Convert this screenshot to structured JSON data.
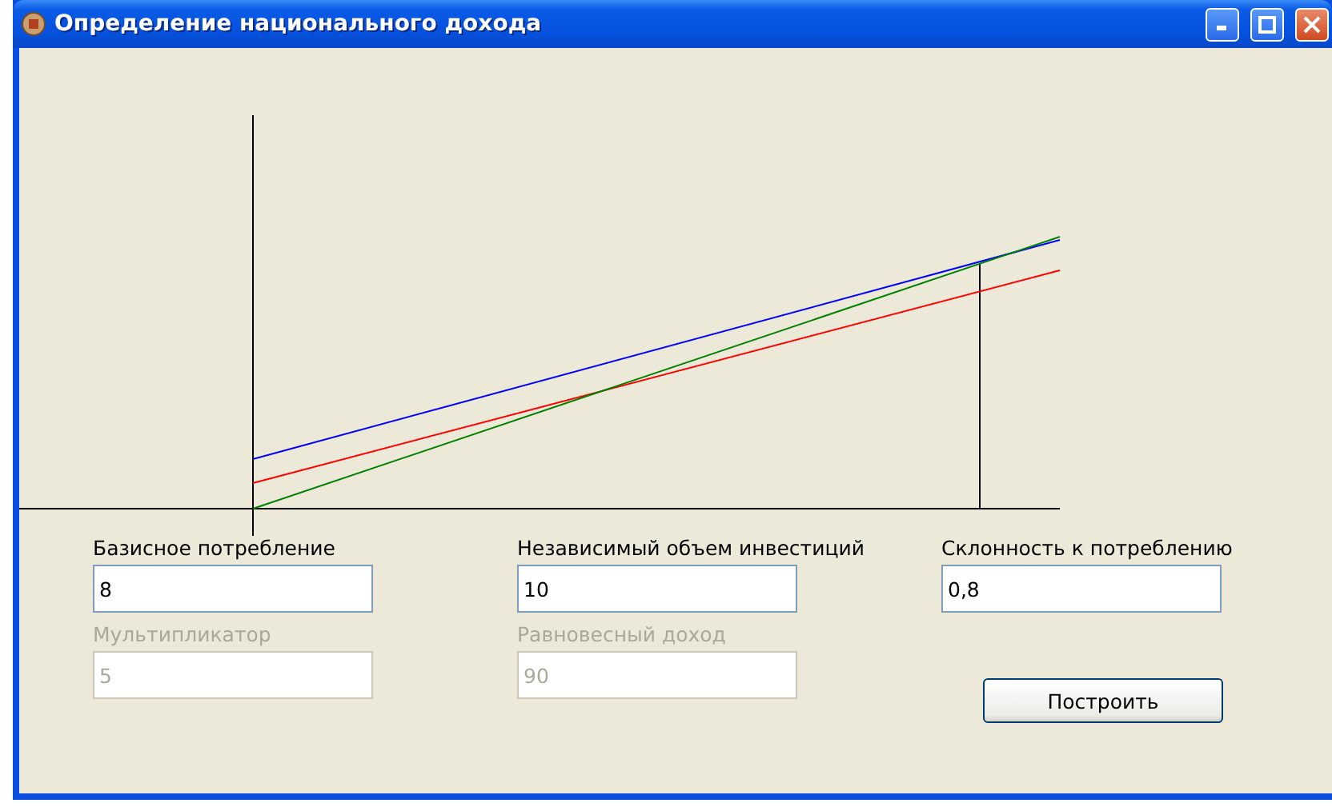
{
  "window": {
    "title": "Определение национального дохода"
  },
  "fields": [
    {
      "label": "Базисное потребление",
      "value": "8",
      "disabled": false
    },
    {
      "label": "Независимый объем инвестиций",
      "value": "10",
      "disabled": false
    },
    {
      "label": "Склонность к потреблению",
      "value": "0,8",
      "disabled": false
    },
    {
      "label": "Мультипликатор",
      "value": "5",
      "disabled": true
    },
    {
      "label": "Равновесный доход",
      "value": "90",
      "disabled": true
    }
  ],
  "build_button": {
    "label": "Построить"
  }
}
